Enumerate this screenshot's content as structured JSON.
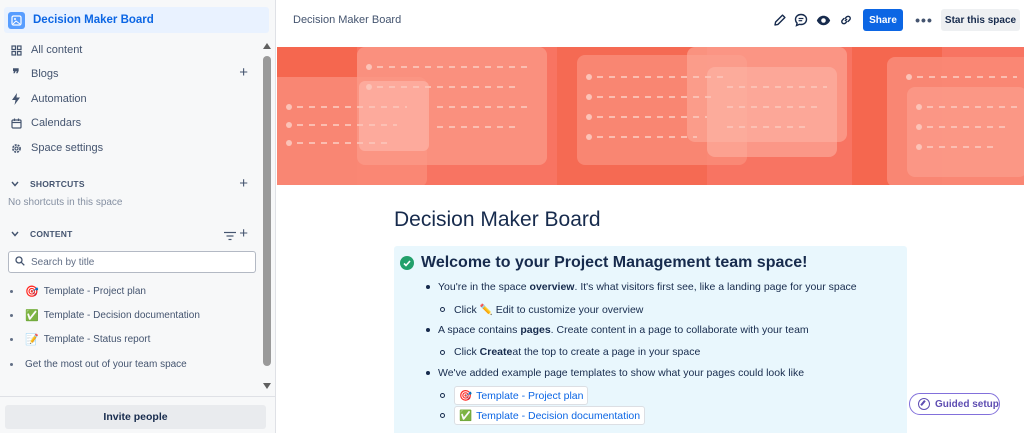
{
  "space": {
    "name": "Decision Maker Board"
  },
  "sidebar": {
    "nav": [
      {
        "label": "All content",
        "icon": "grid-icon"
      },
      {
        "label": "Blogs",
        "icon": "quote-icon"
      },
      {
        "label": "Automation",
        "icon": "lightning-icon"
      },
      {
        "label": "Calendars",
        "icon": "calendar-icon"
      },
      {
        "label": "Space settings",
        "icon": "gear-icon"
      }
    ],
    "shortcuts": {
      "header": "SHORTCUTS",
      "empty_text": "No shortcuts in this space"
    },
    "content": {
      "header": "CONTENT",
      "search_placeholder": "Search by title",
      "items": [
        {
          "emoji": "🎯",
          "label": "Template - Project plan"
        },
        {
          "emoji": "✅",
          "label": "Template - Decision documentation"
        },
        {
          "emoji": "📝",
          "label": "Template - Status report"
        },
        {
          "emoji": "",
          "label": "Get the most out of your team space"
        }
      ]
    },
    "invite_label": "Invite people"
  },
  "topbar": {
    "breadcrumb": "Decision Maker Board",
    "share_label": "Share",
    "more_label": "•••",
    "star_label": "Star this space"
  },
  "page": {
    "title": "Decision Maker Board",
    "panel": {
      "heading": "Welcome to your Project Management team space!",
      "b1_pre": "You're in the space ",
      "b1_bold": "overview",
      "b1_post": ". It's what visitors first see, like a landing page for your space",
      "b1_sub_pre": "Click ",
      "b1_sub_emoji": "✏️",
      "b1_sub_post": " Edit to customize your overview",
      "b2_pre": "A space contains ",
      "b2_bold": "pages",
      "b2_post": ". Create content in a page to collaborate with your team",
      "b2_sub_pre": "Click ",
      "b2_sub_bold": "Create",
      "b2_sub_post": " at the top to create a page in your space",
      "b3": "We've added example page templates to show what your pages could look like",
      "links": [
        {
          "emoji": "🎯",
          "label": "Template - Project plan"
        },
        {
          "emoji": "✅",
          "label": "Template - Decision documentation"
        }
      ]
    }
  },
  "guided_setup_label": "Guided setup",
  "colors": {
    "accent": "#0c66e4",
    "banner": "#f87462",
    "panel_bg": "#e9f7fd",
    "success": "#22a06b"
  }
}
